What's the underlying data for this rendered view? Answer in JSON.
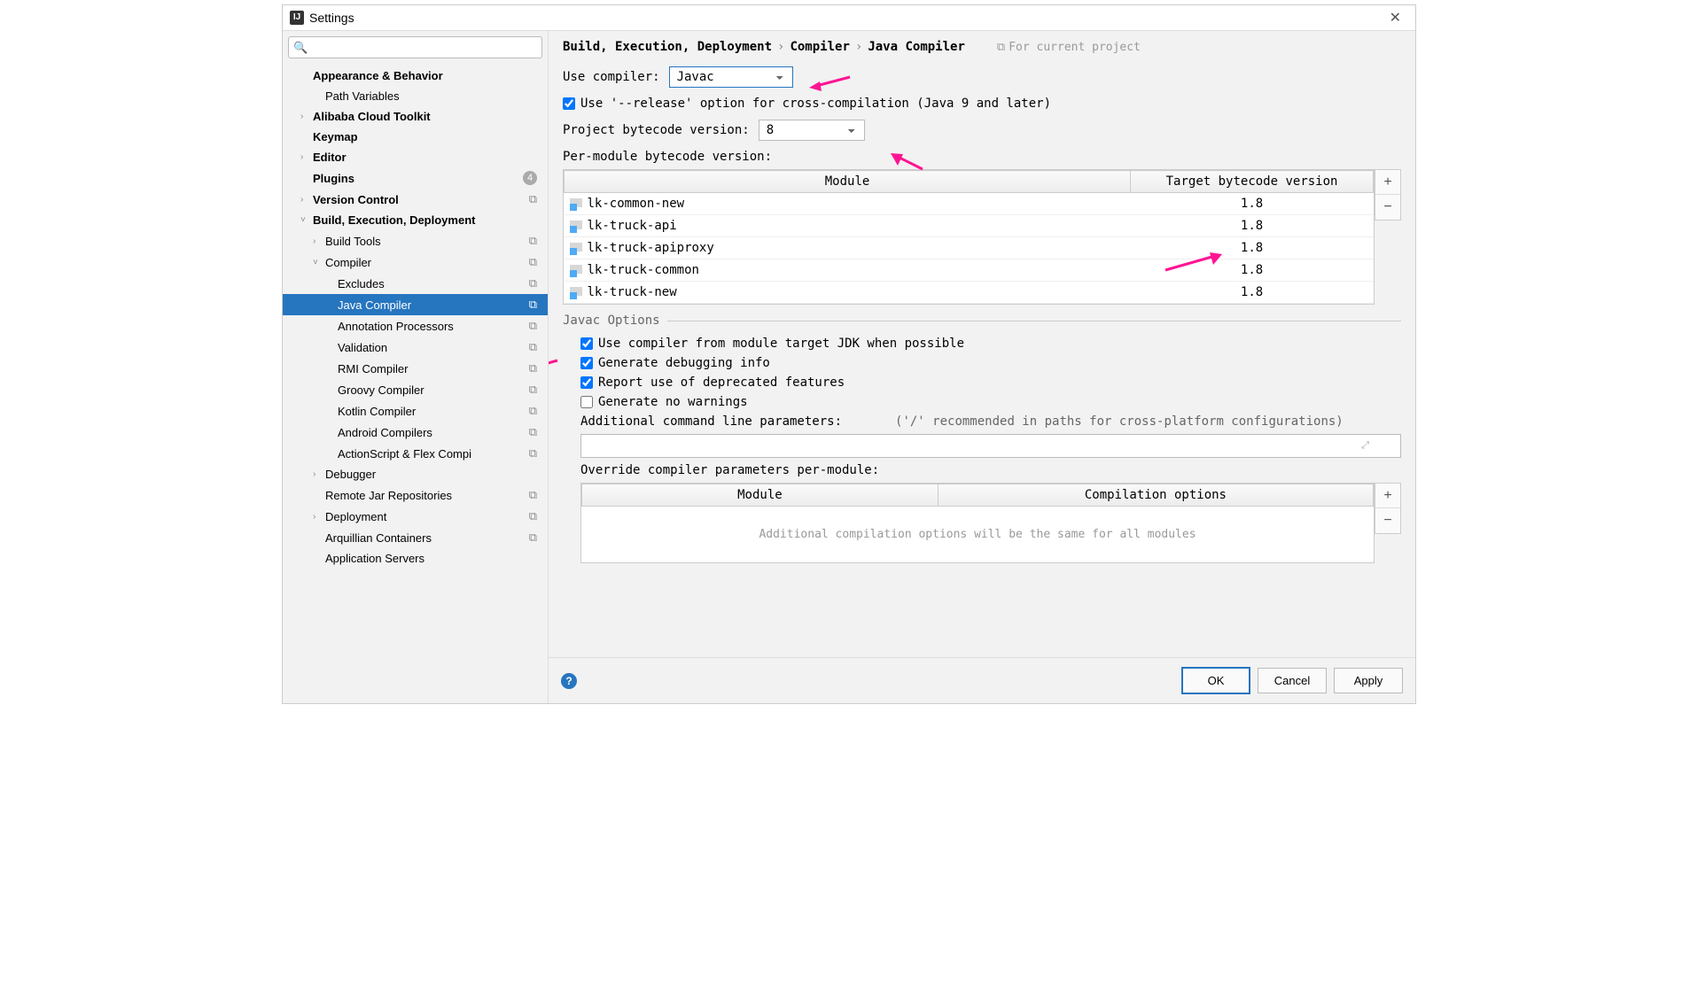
{
  "window": {
    "title": "Settings"
  },
  "search": {
    "placeholder": ""
  },
  "sidebar": {
    "items": [
      {
        "label": "Appearance & Behavior",
        "bold": true,
        "indent": 0,
        "chev": "",
        "tag": ""
      },
      {
        "label": "Path Variables",
        "bold": false,
        "indent": 1,
        "chev": "",
        "tag": ""
      },
      {
        "label": "Alibaba Cloud Toolkit",
        "bold": true,
        "indent": 0,
        "chev": ">",
        "tag": ""
      },
      {
        "label": "Keymap",
        "bold": true,
        "indent": 0,
        "chev": "",
        "tag": ""
      },
      {
        "label": "Editor",
        "bold": true,
        "indent": 0,
        "chev": ">",
        "tag": ""
      },
      {
        "label": "Plugins",
        "bold": true,
        "indent": 0,
        "chev": "",
        "badge": "4",
        "tag": ""
      },
      {
        "label": "Version Control",
        "bold": true,
        "indent": 0,
        "chev": ">",
        "tag": "⧉"
      },
      {
        "label": "Build, Execution, Deployment",
        "bold": true,
        "indent": 0,
        "chev": "v",
        "tag": ""
      },
      {
        "label": "Build Tools",
        "bold": false,
        "indent": 1,
        "chev": ">",
        "tag": "⧉"
      },
      {
        "label": "Compiler",
        "bold": false,
        "indent": 1,
        "chev": "v",
        "tag": "⧉"
      },
      {
        "label": "Excludes",
        "bold": false,
        "indent": 2,
        "chev": "",
        "tag": "⧉"
      },
      {
        "label": "Java Compiler",
        "bold": false,
        "indent": 2,
        "chev": "",
        "tag": "⧉",
        "selected": true
      },
      {
        "label": "Annotation Processors",
        "bold": false,
        "indent": 2,
        "chev": "",
        "tag": "⧉"
      },
      {
        "label": "Validation",
        "bold": false,
        "indent": 2,
        "chev": "",
        "tag": "⧉"
      },
      {
        "label": "RMI Compiler",
        "bold": false,
        "indent": 2,
        "chev": "",
        "tag": "⧉"
      },
      {
        "label": "Groovy Compiler",
        "bold": false,
        "indent": 2,
        "chev": "",
        "tag": "⧉"
      },
      {
        "label": "Kotlin Compiler",
        "bold": false,
        "indent": 2,
        "chev": "",
        "tag": "⧉"
      },
      {
        "label": "Android Compilers",
        "bold": false,
        "indent": 2,
        "chev": "",
        "tag": "⧉"
      },
      {
        "label": "ActionScript & Flex Compi",
        "bold": false,
        "indent": 2,
        "chev": "",
        "tag": "⧉"
      },
      {
        "label": "Debugger",
        "bold": false,
        "indent": 1,
        "chev": ">",
        "tag": ""
      },
      {
        "label": "Remote Jar Repositories",
        "bold": false,
        "indent": 1,
        "chev": "",
        "tag": "⧉"
      },
      {
        "label": "Deployment",
        "bold": false,
        "indent": 1,
        "chev": ">",
        "tag": "⧉"
      },
      {
        "label": "Arquillian Containers",
        "bold": false,
        "indent": 1,
        "chev": "",
        "tag": "⧉"
      },
      {
        "label": "Application Servers",
        "bold": false,
        "indent": 1,
        "chev": "",
        "tag": ""
      }
    ]
  },
  "breadcrumb": {
    "a": "Build, Execution, Deployment",
    "b": "Compiler",
    "c": "Java Compiler",
    "scope": "For current project"
  },
  "form": {
    "use_compiler_label": "Use compiler:",
    "use_compiler_value": "Javac",
    "release_opt": "Use '--release' option for cross-compilation (Java 9 and later)",
    "project_bc_label": "Project bytecode version:",
    "project_bc_value": "8",
    "per_module_label": "Per-module bytecode version:"
  },
  "module_table": {
    "col_module": "Module",
    "col_target": "Target bytecode version",
    "rows": [
      {
        "name": "lk-common-new",
        "ver": "1.8"
      },
      {
        "name": "lk-truck-api",
        "ver": "1.8"
      },
      {
        "name": "lk-truck-apiproxy",
        "ver": "1.8"
      },
      {
        "name": "lk-truck-common",
        "ver": "1.8"
      },
      {
        "name": "lk-truck-new",
        "ver": "1.8"
      }
    ]
  },
  "javac": {
    "title": "Javac Options",
    "opt1": "Use compiler from module target JDK when possible",
    "opt2": "Generate debugging info",
    "opt3": "Report use of deprecated features",
    "opt4": "Generate no warnings",
    "addl_label": "Additional command line parameters:",
    "addl_hint": "('/' recommended in paths for cross-platform configurations)",
    "override_label": "Override compiler parameters per-module:",
    "override_col1": "Module",
    "override_col2": "Compilation options",
    "override_empty": "Additional compilation options will be the same for all modules"
  },
  "buttons": {
    "ok": "OK",
    "cancel": "Cancel",
    "apply": "Apply"
  }
}
